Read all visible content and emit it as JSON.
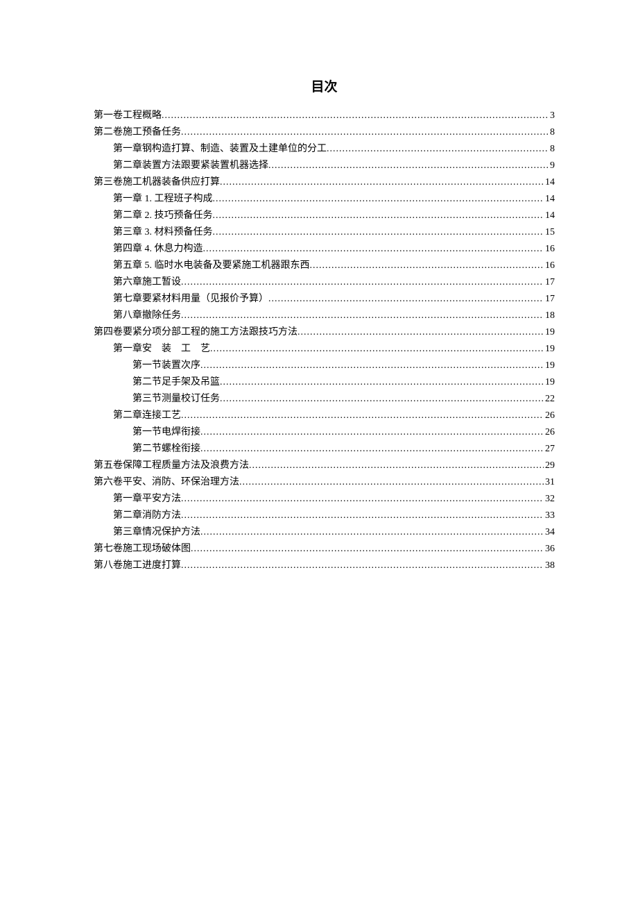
{
  "title": "目次",
  "toc": [
    {
      "level": 0,
      "label": "第一卷工程概略",
      "page": "3"
    },
    {
      "level": 0,
      "label": "第二卷施工预备任务",
      "page": "8"
    },
    {
      "level": 1,
      "label": "第一章钢构造打算、制造、装置及土建单位的分工",
      "page": "8"
    },
    {
      "level": 1,
      "label": "第二章装置方法跟要紧装置机器选择",
      "page": "9"
    },
    {
      "level": 0,
      "label": "第三卷施工机器装备供应打算",
      "page": "14"
    },
    {
      "level": 1,
      "label": "第一章 1. 工程班子构成",
      "page": "14"
    },
    {
      "level": 1,
      "label": "第二章 2. 技巧预备任务",
      "page": "14"
    },
    {
      "level": 1,
      "label": "第三章 3. 材料预备任务",
      "page": "15"
    },
    {
      "level": 1,
      "label": "第四章 4. 休息力构造",
      "page": "16"
    },
    {
      "level": 1,
      "label": "第五章 5. 临时水电装备及要紧施工机器跟东西",
      "page": "16"
    },
    {
      "level": 1,
      "label": "第六章施工暂设",
      "page": "17"
    },
    {
      "level": 1,
      "label": "第七章要紧材料用量（见报价予算）",
      "page": "17"
    },
    {
      "level": 1,
      "label": "第八章撤除任务",
      "page": "18"
    },
    {
      "level": 0,
      "label": "第四卷要紧分项分部工程的施工方法跟技巧方法",
      "page": "19"
    },
    {
      "level": 1,
      "label": "第一章安　装　工　艺",
      "page": "19"
    },
    {
      "level": 2,
      "label": "第一节装置次序",
      "page": "19"
    },
    {
      "level": 2,
      "label": "第二节足手架及吊篮",
      "page": "19"
    },
    {
      "level": 2,
      "label": "第三节测量校订任务",
      "page": "22"
    },
    {
      "level": 1,
      "label": "第二章连接工艺",
      "page": "26"
    },
    {
      "level": 2,
      "label": "第一节电焊衔接",
      "page": "26"
    },
    {
      "level": 2,
      "label": "第二节螺栓衔接",
      "page": "27"
    },
    {
      "level": 0,
      "label": "第五卷保障工程质量方法及浪费方法",
      "page": "29"
    },
    {
      "level": 0,
      "label": "第六卷平安、消防、环保治理方法",
      "page": "31"
    },
    {
      "level": 1,
      "label": "第一章平安方法",
      "page": "32"
    },
    {
      "level": 1,
      "label": "第二章消防方法",
      "page": "33"
    },
    {
      "level": 1,
      "label": "第三章情况保护方法",
      "page": "34"
    },
    {
      "level": 0,
      "label": "第七卷施工现场破体图",
      "page": "36"
    },
    {
      "level": 0,
      "label": "第八卷施工进度打算",
      "page": "38"
    }
  ]
}
